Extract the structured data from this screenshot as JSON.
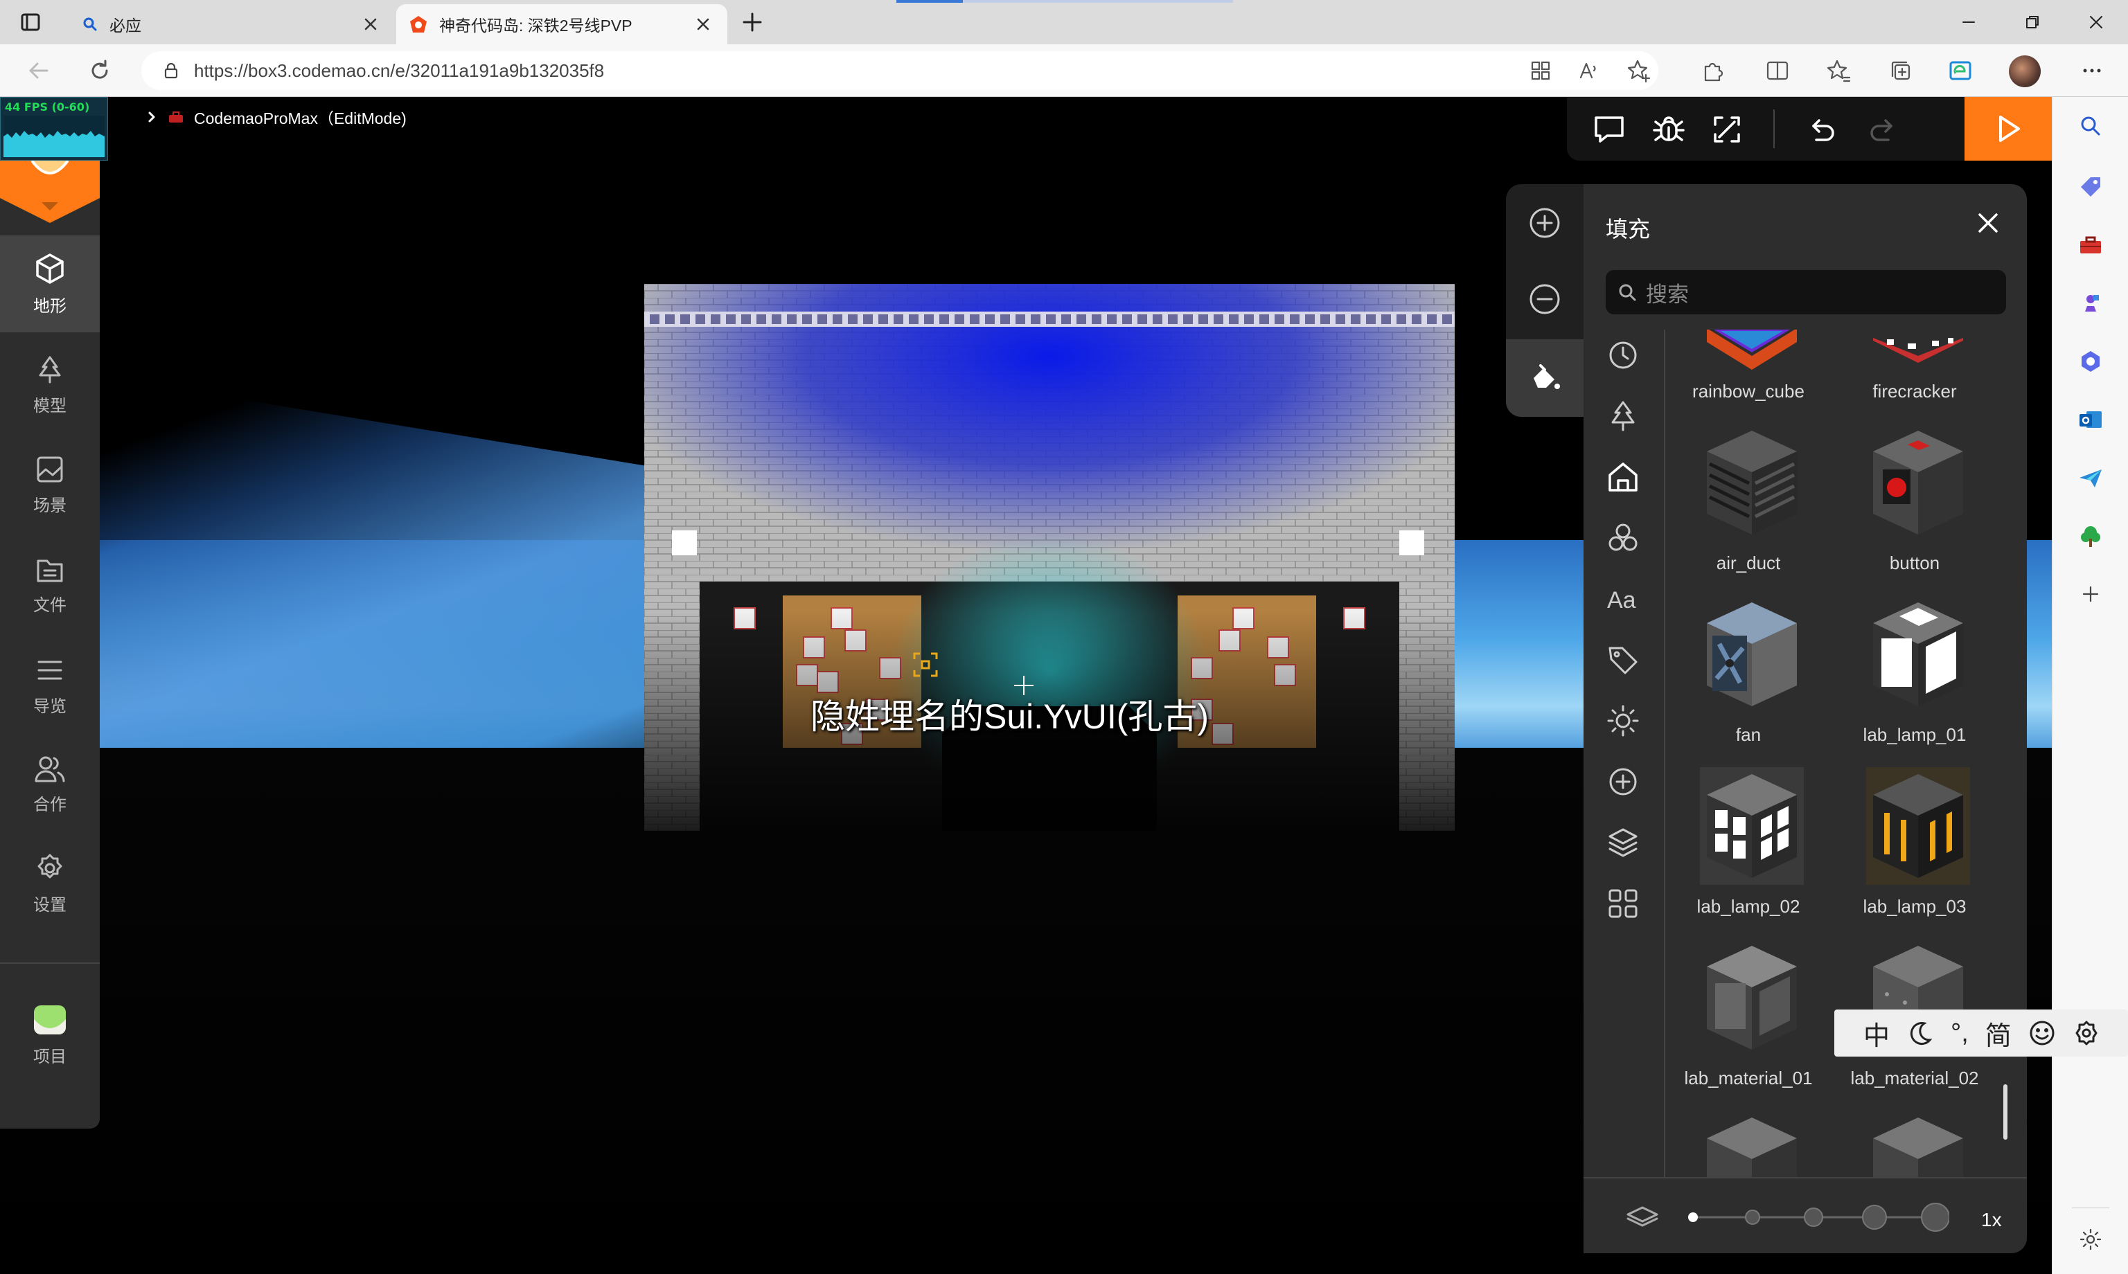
{
  "browser": {
    "tabs": [
      {
        "title": "必应",
        "active": false
      },
      {
        "title": "神奇代码岛: 深铁2号线PVP",
        "active": true
      }
    ],
    "url": "https://box3.codemao.cn/e/32011a191a9b132035f8"
  },
  "game": {
    "fps": "44 FPS (0-60)",
    "breadcrumb": "CodemaoProMax（EditMode)",
    "player_name": "隐姓埋名的Sui.YvUI(孔古)"
  },
  "left_sidebar": {
    "items": [
      {
        "label": "地形",
        "icon": "cube-icon",
        "active": true
      },
      {
        "label": "模型",
        "icon": "tree-icon",
        "active": false
      },
      {
        "label": "场景",
        "icon": "image-icon",
        "active": false
      },
      {
        "label": "文件",
        "icon": "file-icon",
        "active": false
      },
      {
        "label": "导览",
        "icon": "list-icon",
        "active": false
      },
      {
        "label": "合作",
        "icon": "users-icon",
        "active": false
      },
      {
        "label": "设置",
        "icon": "gear-icon",
        "active": false
      },
      {
        "label": "项目",
        "icon": "project-icon",
        "active": false
      }
    ]
  },
  "fill_panel": {
    "title": "填充",
    "search_placeholder": "搜索",
    "blocks": [
      {
        "name": "rainbow_cube"
      },
      {
        "name": "firecracker"
      },
      {
        "name": "air_duct"
      },
      {
        "name": "button"
      },
      {
        "name": "fan"
      },
      {
        "name": "lab_lamp_01"
      },
      {
        "name": "lab_lamp_02"
      },
      {
        "name": "lab_lamp_03"
      },
      {
        "name": "lab_material_01"
      },
      {
        "name": "lab_material_02"
      }
    ],
    "speed": "1x"
  },
  "ime": {
    "mode": "中",
    "punct": "°,",
    "script": "简"
  },
  "colors": {
    "accent": "#ff7a14",
    "sidebar_bg": "#2d2d2d",
    "panel_bg": "#2d2d2d"
  }
}
